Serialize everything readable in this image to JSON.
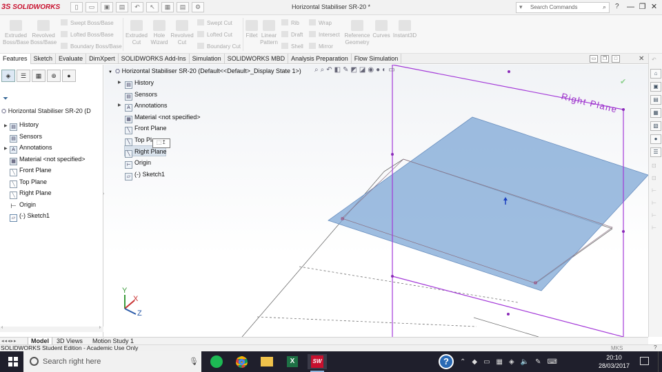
{
  "app": {
    "logo_prefix": "3S",
    "logo_text": "SOLIDWORKS",
    "title": "Horizontal Stabiliser SR-20 *"
  },
  "search": {
    "placeholder": "Search Commands",
    "icon": "search-icon"
  },
  "window_controls": {
    "help": "?",
    "minimize": "—",
    "restore": "❐",
    "close": "✕"
  },
  "ribbon": {
    "extruded_boss": "Extruded Boss/Base",
    "revolved_boss": "Revolved Boss/Base",
    "swept_boss": "Swept Boss/Base",
    "lofted_boss": "Lofted Boss/Base",
    "boundary_boss": "Boundary Boss/Base",
    "extruded_cut": "Extruded Cut",
    "hole_wizard": "Hole Wizard",
    "revolved_cut": "Revolved Cut",
    "swept_cut": "Swept Cut",
    "lofted_cut": "Lofted Cut",
    "boundary_cut": "Boundary Cut",
    "fillet": "Fillet",
    "linear_pattern": "Linear Pattern",
    "rib": "Rib",
    "draft": "Draft",
    "shell": "Shell",
    "wrap": "Wrap",
    "intersect": "Intersect",
    "mirror": "Mirror",
    "reference_geometry": "Reference Geometry",
    "curves": "Curves",
    "instant3d": "Instant3D"
  },
  "tabs": [
    "Features",
    "Sketch",
    "Evaluate",
    "DimXpert",
    "SOLIDWORKS Add-Ins",
    "Simulation",
    "SOLIDWORKS MBD",
    "Analysis Preparation",
    "Flow Simulation"
  ],
  "active_tab": "Features",
  "feature_tree": {
    "root": "Horizontal Stabiliser SR-20  (D",
    "items": [
      "History",
      "Sensors",
      "Annotations",
      "Material <not specified>",
      "Front Plane",
      "Top Plane",
      "Right Plane",
      "Origin",
      "(-) Sketch1"
    ]
  },
  "flyout_tree": {
    "root": "Horizontal Stabiliser SR-20  (Default<<Default>_Display State 1>)",
    "items": [
      "History",
      "Sensors",
      "Annotations",
      "Material <not specified>",
      "Front Plane",
      "Top Plane",
      "Right Plane",
      "Origin",
      "(-) Sketch1"
    ],
    "highlighted": "Right Plane"
  },
  "viewport": {
    "plane_label": "Right Plane",
    "triad": {
      "x": "X",
      "y": "Y",
      "z": "Z"
    }
  },
  "colors": {
    "plane_fill": "#7ea7d6",
    "plane_outline": "#a338d8",
    "brand": "#c8102e"
  },
  "bottom_tabs": [
    "Model",
    "3D Views",
    "Motion Study 1"
  ],
  "status": {
    "text": "SOLIDWORKS Student Edition - Academic Use Only",
    "units": "MKS",
    "help": "?"
  },
  "taskbar": {
    "search_placeholder": "Search right here",
    "time": "20:10",
    "date": "28/03/2017"
  }
}
